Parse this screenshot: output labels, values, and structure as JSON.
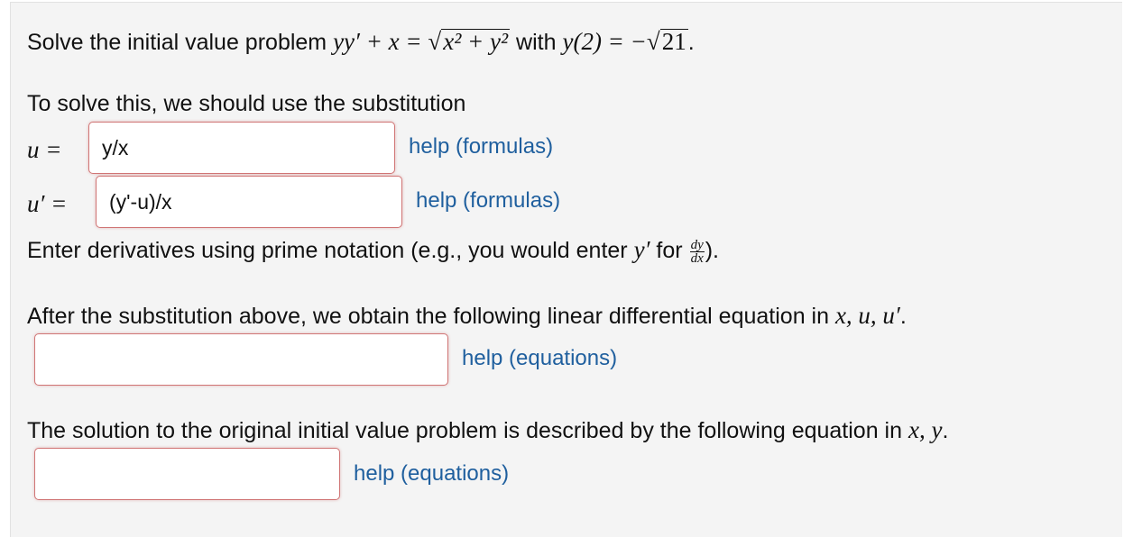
{
  "problem": {
    "prefix": "Solve the initial value problem ",
    "equation_lhs": "yy′ + x = ",
    "sqrt_content": "x² + y²",
    "mid": " with ",
    "condition": "y(2) = −",
    "sqrt_value": "21",
    "suffix": "."
  },
  "substitution_intro": "To solve this, we should use the substitution",
  "fields": {
    "u": {
      "label": "u =",
      "value": "y/x"
    },
    "u_prime": {
      "label": "u′ =",
      "value": "(y'-u)/x"
    },
    "linear_eq": {
      "value": ""
    },
    "solution_eq": {
      "value": ""
    }
  },
  "help_links": {
    "formulas_1": "help (formulas)",
    "formulas_2": "help (formulas)",
    "equations_1": "help (equations)",
    "equations_2": "help (equations)"
  },
  "derivative_note": {
    "prefix": "Enter derivatives using prime notation (e.g., you would enter ",
    "y_prime": "y′",
    "for": " for ",
    "frac_num": "dy",
    "frac_den": "dx",
    "suffix": ")."
  },
  "linear_prompt": {
    "text": "After the substitution above, we obtain the following linear differential equation in ",
    "vars": "x, u, u′",
    "suffix": "."
  },
  "solution_prompt": {
    "text": "The solution to the original initial value problem is described by the following equation in ",
    "vars": "x, y",
    "suffix": "."
  },
  "colors": {
    "panel_bg": "#f4f4f4",
    "field_border": "#d07575",
    "link": "#1f5f9e"
  }
}
